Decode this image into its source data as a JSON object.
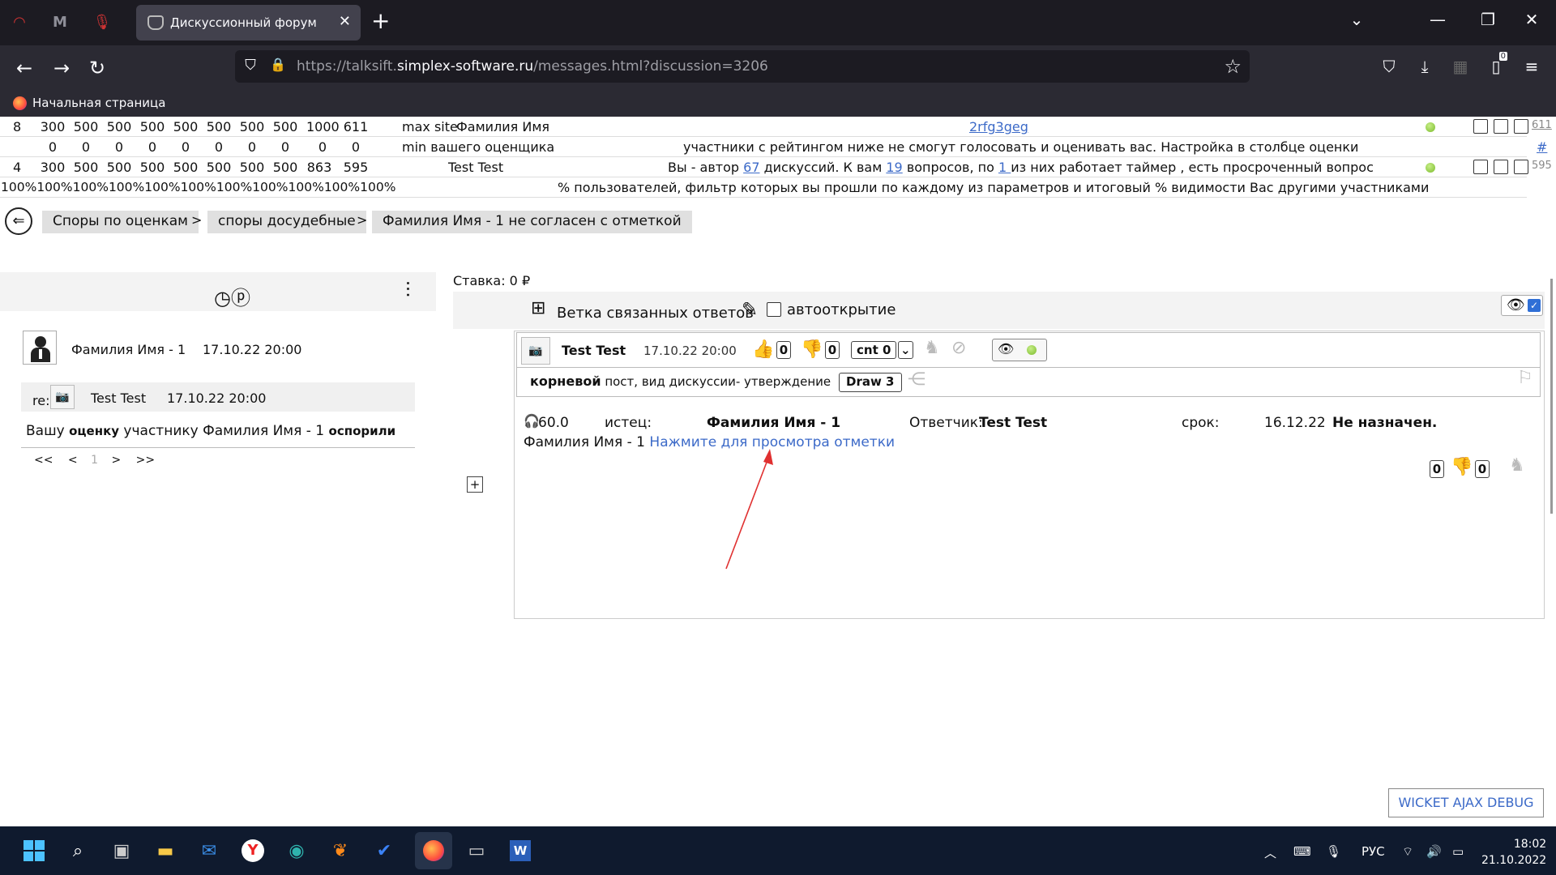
{
  "browser": {
    "tab_title": "Дискуссионный форум",
    "url_prefix": "https://talksift.",
    "url_host": "simplex-software.ru",
    "url_path": "/messages.html?discussion=3206",
    "bookmark": "Начальная страница",
    "tab_count_badge": "0"
  },
  "stats": {
    "row1": {
      "index": "8",
      "values": [
        "300",
        "500",
        "500",
        "500",
        "500",
        "500",
        "500",
        "500",
        "1000",
        "611"
      ],
      "label": "max site",
      "name": "Фамилия Имя",
      "link": "2rfg3geg",
      "end": "611"
    },
    "row2": {
      "values": [
        "0",
        "0",
        "0",
        "0",
        "0",
        "0",
        "0",
        "0",
        "0",
        "0"
      ],
      "label": "min вашего оценщика",
      "note": "участники с рейтингом ниже не смогут голосовать и оценивать вас. Настройка в столбце оценки",
      "end": "#"
    },
    "row3": {
      "index": "4",
      "values": [
        "300",
        "500",
        "500",
        "500",
        "500",
        "500",
        "500",
        "500",
        "863",
        "595"
      ],
      "name": "Test Test",
      "note_a": "Вы - автор ",
      "n_discussions": "67",
      "note_b": " дискуссий. К вам ",
      "n_questions": "19",
      "note_c": " вопросов, по ",
      "n_timer": "1 ",
      "note_d": "из них работает таймер , есть просроченный вопрос",
      "end": "595"
    },
    "row4": {
      "percents": "100%100%100%100%100%100%100%100%100%100%100%",
      "note": "% пользователей, фильтр которых вы прошли по каждому из параметров и итоговый % видимости Вас другими участниками"
    }
  },
  "breadcrumbs": {
    "c1": "Споры по оценкам",
    "c2": "споры досудебные",
    "c3": "Фамилия Имя - 1 не согласен с отметкой",
    "sep": ">"
  },
  "left": {
    "author": "Фамилия Имя - 1",
    "date": "17.10.22 20:00",
    "re_label": "re:",
    "reply_author": "Test Test",
    "reply_date": "17.10.22 20:00",
    "msg_a": "Вашу ",
    "msg_b": "оценку",
    "msg_c": " участнику Фамилия Имя - 1 ",
    "msg_d": "оспорили",
    "pager": {
      "first": "<<",
      "prev": "<",
      "page": "1",
      "next": ">",
      "last": ">>"
    }
  },
  "right": {
    "stake": "Ставка: 0 ₽",
    "branch_label": "Ветка связанных ответов",
    "autoopen": "автооткрытие",
    "post": {
      "author": "Test Test",
      "date": "17.10.22 20:00",
      "likes": "0",
      "dislikes": "0",
      "cnt": "cnt 0",
      "root": "корневой",
      "kind": " пост, вид дискуссии- утверждение",
      "draw": "Draw 3",
      "score": "60.0",
      "plaintiff_label": "истец:",
      "plaintiff": "Фамилия Имя - 1",
      "defendant_label": "Ответчик:",
      "defendant": "Test Test",
      "term_label": "срок:",
      "term_date": "16.12.22",
      "status": "Не назначен.",
      "line2_name": "Фамилия Имя - 1 ",
      "line2_link": "Нажмите для просмотра отметки",
      "foot_likes": "0",
      "foot_dislikes": "0"
    }
  },
  "debug_button": "WICKET AJAX DEBUG",
  "taskbar": {
    "lang": "РУС",
    "time": "18:02",
    "date": "21.10.2022"
  },
  "colors": {
    "link": "#3c6ac8",
    "titlebar": "#1c1b22",
    "navbar": "#2b2a33",
    "taskbar": "#0f1a2e",
    "arrow": "#e03030"
  }
}
